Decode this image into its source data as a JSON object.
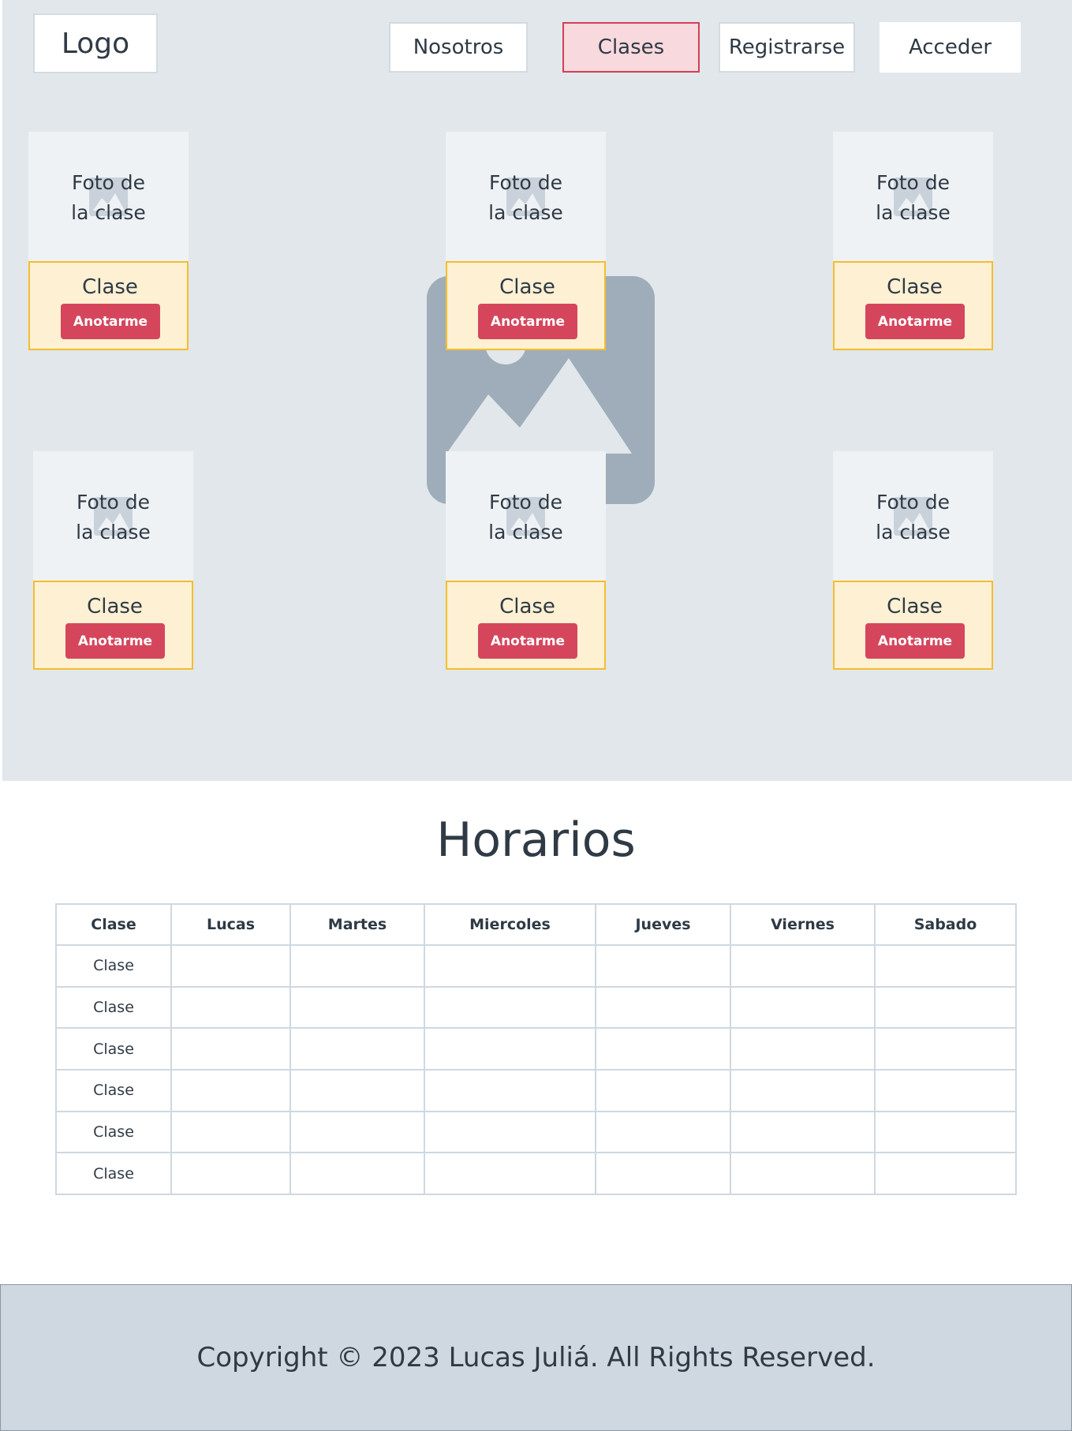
{
  "nav": {
    "logo": "Logo",
    "items": [
      {
        "label": "Nosotros"
      },
      {
        "label": "Clases"
      },
      {
        "label": "Registrarse"
      },
      {
        "label": "Acceder"
      }
    ]
  },
  "hero": {
    "background_icon": "image-placeholder-icon"
  },
  "classes": [
    {
      "photo_label_line1": "Foto de",
      "photo_label_line2": "la clase",
      "title": "Clase",
      "button": "Anotarme"
    },
    {
      "photo_label_line1": "Foto de",
      "photo_label_line2": "la clase",
      "title": "Clase",
      "button": "Anotarme"
    },
    {
      "photo_label_line1": "Foto de",
      "photo_label_line2": "la clase",
      "title": "Clase",
      "button": "Anotarme"
    },
    {
      "photo_label_line1": "Foto de",
      "photo_label_line2": "la clase",
      "title": "Clase",
      "button": "Anotarme"
    },
    {
      "photo_label_line1": "Foto de",
      "photo_label_line2": "la clase",
      "title": "Clase",
      "button": "Anotarme"
    },
    {
      "photo_label_line1": "Foto de",
      "photo_label_line2": "la clase",
      "title": "Clase",
      "button": "Anotarme"
    }
  ],
  "schedule": {
    "title": "Horarios",
    "columns": [
      "Clase",
      "Lucas",
      "Martes",
      "Miercoles",
      "Jueves",
      "Viernes",
      "Sabado"
    ],
    "rows": [
      [
        "Clase",
        "",
        "",
        "",
        "",
        "",
        ""
      ],
      [
        "Clase",
        "",
        "",
        "",
        "",
        "",
        ""
      ],
      [
        "Clase",
        "",
        "",
        "",
        "",
        "",
        ""
      ],
      [
        "Clase",
        "",
        "",
        "",
        "",
        "",
        ""
      ],
      [
        "Clase",
        "",
        "",
        "",
        "",
        "",
        ""
      ],
      [
        "Clase",
        "",
        "",
        "",
        "",
        "",
        ""
      ]
    ]
  },
  "footer": {
    "copyright": "Copyright © 2023 Lucas Juliá. All Rights Reserved."
  },
  "colors": {
    "hero_bg": "#e2e7eb",
    "card_body_bg": "#fdf0d3",
    "card_body_border": "#f4be2e",
    "button": "#d5465c",
    "active_nav_bg": "#f8d9de",
    "active_nav_border": "#d43f57",
    "footer_bg": "#cfd8e0"
  }
}
